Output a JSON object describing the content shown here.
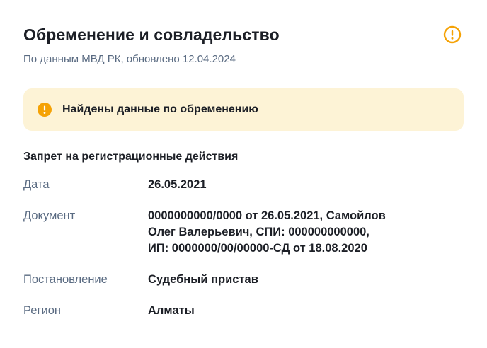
{
  "header": {
    "title": "Обременение и совладельство",
    "subtitle": "По данным МВД РК, обновлено 12.04.2024"
  },
  "alert": {
    "text": "Найдены данные по обременению"
  },
  "colors": {
    "warning": "#f5a205",
    "alert_bg": "#fdf3d6",
    "muted_text": "#5a6b82"
  },
  "icons": {
    "header_status": "warning-circle-icon",
    "alert": "warning-filled-icon"
  },
  "section": {
    "title": "Запрет на регистрационные действия",
    "rows": [
      {
        "label": "Дата",
        "value_lines": [
          "26.05.2021"
        ]
      },
      {
        "label": "Документ",
        "value_lines": [
          "0000000000/0000 от 26.05.2021, Самойлов",
          "Олег Валерьевич, СПИ: 000000000000,",
          "ИП: 0000000/00/00000-СД от 18.08.2020"
        ]
      },
      {
        "label": "Постановление",
        "value_lines": [
          "Судебный пристав"
        ]
      },
      {
        "label": "Регион",
        "value_lines": [
          "Алматы"
        ]
      }
    ]
  }
}
